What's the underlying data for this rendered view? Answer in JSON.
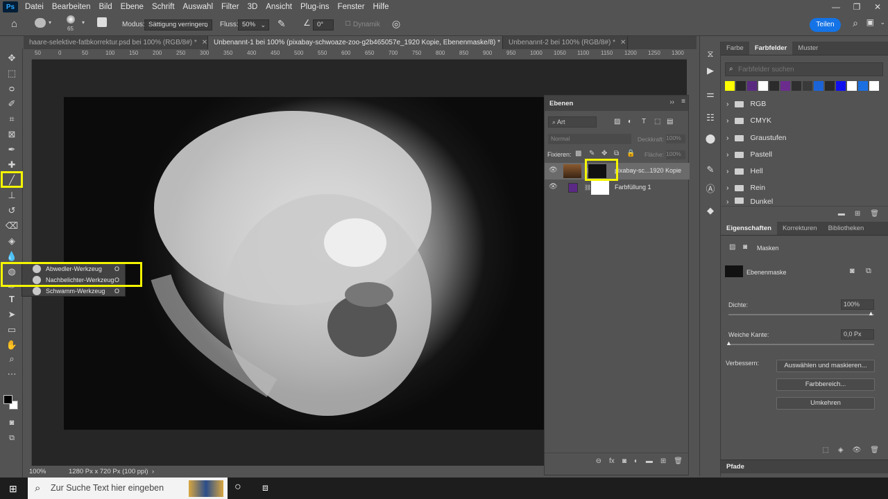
{
  "menu": {
    "app_logo": "Ps",
    "items": [
      "Datei",
      "Bearbeiten",
      "Bild",
      "Ebene",
      "Schrift",
      "Auswahl",
      "Filter",
      "3D",
      "Ansicht",
      "Plug-ins",
      "Fenster",
      "Hilfe"
    ],
    "window_buttons": [
      "—",
      "❐",
      "✕"
    ]
  },
  "options": {
    "brush_size": "65",
    "mode_label": "Modus:",
    "mode_value": "Sättigung verringern",
    "flow_label": "Fluss:",
    "flow_value": "50%",
    "angle_value": "0°",
    "dynamic_label": "Dynamik",
    "share_label": "Teilen"
  },
  "tabs": [
    {
      "label": "haare-selektive-fatbkorrektur.psd bei 100% (RGB/8#) *"
    },
    {
      "label": "Unbenannt-1 bei 100% (pixabay-schwoaze-zoo-g2b465057e_1920 Kopie, Ebenenmaske/8) *"
    },
    {
      "label": "Unbenannt-2 bei 100% (RGB/8#) *"
    }
  ],
  "ruler_top": [
    "50",
    "0",
    "50",
    "100",
    "150",
    "200",
    "250",
    "300",
    "350",
    "400",
    "450",
    "500",
    "550",
    "600",
    "650",
    "700",
    "750",
    "800",
    "850",
    "900",
    "950",
    "1000",
    "1050",
    "1100",
    "1150",
    "1200",
    "1250",
    "1300"
  ],
  "tool_flyout": [
    {
      "label": "Abwedler-Werkzeug",
      "key": "O"
    },
    {
      "label": "Nachbelichter-Werkzeug",
      "key": "O"
    },
    {
      "label": "Schwamm-Werkzeug",
      "key": "O"
    }
  ],
  "status": {
    "zoom": "100%",
    "info": "1280 Px x 720 Px (100 ppi)"
  },
  "layers_panel": {
    "title": "Ebenen",
    "filter": "Art",
    "blend_mode": "Normal",
    "opacity_label": "Deckkraft:",
    "opacity_value": "100%",
    "lock_label": "Fixieren:",
    "fill_label": "Fläche:",
    "fill_value": "100%",
    "layers": [
      {
        "name": "pixabay-sc...1920 Kopie",
        "selected": true
      },
      {
        "name": "Farbfüllung 1",
        "selected": false
      }
    ]
  },
  "swatches_panel": {
    "tabs": [
      "Farbe",
      "Farbfelder",
      "Muster"
    ],
    "search_placeholder": "Farbfelder suchen",
    "colors": [
      "#ffff00",
      "#2a2a2a",
      "#5a2a80",
      "#ffffff",
      "#2b2b2b",
      "#6b2c8e",
      "#2f2f2f",
      "#3a3a3a",
      "#1b64d8",
      "#2a2a2a",
      "#1010ee",
      "#ffffff",
      "#1c6fe0",
      "#ffffff"
    ],
    "groups": [
      "RGB",
      "CMYK",
      "Graustufen",
      "Pastell",
      "Hell",
      "Rein",
      "Dunkel"
    ]
  },
  "properties_panel": {
    "tabs": [
      "Eigenschaften",
      "Korrekturen",
      "Bibliotheken"
    ],
    "section": "Masken",
    "mask_type": "Ebenenmaske",
    "density_label": "Dichte:",
    "density_value": "100%",
    "feather_label": "Weiche Kante:",
    "feather_value": "0,0 Px",
    "refine_label": "Verbessern:",
    "buttons": [
      "Auswählen und maskieren...",
      "Farbbereich...",
      "Umkehren"
    ],
    "paths_tab": "Pfade"
  },
  "taskbar": {
    "search_placeholder": "Zur Suche Text hier eingeben"
  },
  "colors": {
    "highlight": "#f5f500",
    "accent": "#1473e6",
    "layer_fill_color": "#5b2a84"
  }
}
